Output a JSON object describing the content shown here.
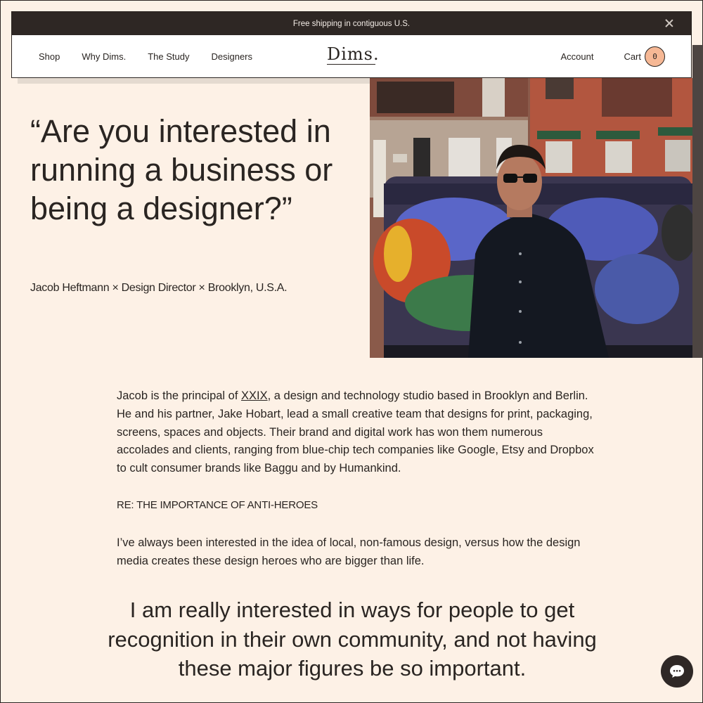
{
  "promo": {
    "text": "Free shipping in contiguous U.S."
  },
  "nav": {
    "links": [
      "Shop",
      "Why Dims.",
      "The Study",
      "Designers"
    ],
    "logo": "Dims.",
    "account": "Account",
    "cart_label": "Cart",
    "cart_count": "0"
  },
  "hero": {
    "quote": "“Are you interested in running a business or being a designer?”",
    "attribution": "Jacob Heftmann × Design Director × Brooklyn, U.S.A."
  },
  "body": {
    "intro_before_link": "Jacob is the principal of ",
    "intro_link": "XXIX",
    "intro_after_link": ", a design and technology studio based in Brooklyn and Berlin. He and his partner, Jake Hobart, lead a small creative team that designs for print, packaging, screens, spaces and objects. Their brand and digital work has won them numerous accolades and clients, ranging from blue-chip tech companies like Google, Etsy and Dropbox to cult consumer brands like Baggu and by Humankind.",
    "section_heading": "RE: THE IMPORTANCE OF ANTI-HEROES",
    "paragraph2": "I’ve always been interested in the idea of local, non-famous design, versus how the design media creates these design heroes who are bigger than life.",
    "pull_quote": "I am really interested in ways for people to get recognition in their own community, and not having these major figures be so important."
  },
  "colors": {
    "page_bg": "#fdf1e6",
    "promo_bg": "#2e2724",
    "cart_badge": "#f6b895",
    "text": "#2a2522"
  },
  "icons": [
    "close-icon",
    "chat-icon"
  ]
}
